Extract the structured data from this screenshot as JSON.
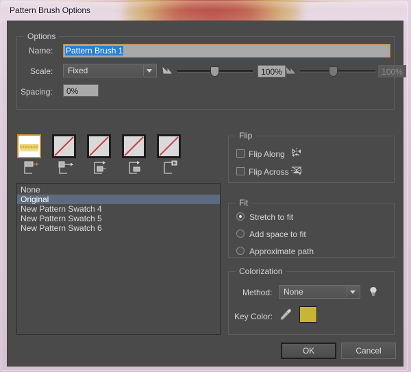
{
  "window": {
    "title": "Pattern Brush Options"
  },
  "options": {
    "group_label": "Options",
    "name_label": "Name:",
    "name_value": "Pattern Brush 1",
    "scale_label": "Scale:",
    "scale_value": "Fixed",
    "scale_slider_value": "100%",
    "scale_slider2_value": "100%",
    "spacing_label": "Spacing:",
    "spacing_value": "0%",
    "slider_icon_name": "scale-corner-icon"
  },
  "tiles": [
    {
      "name": "side-tile",
      "indicator": "side-tile-icon",
      "selected": true,
      "empty": false
    },
    {
      "name": "outer-corner-tile",
      "indicator": "outer-corner-tile-icon",
      "selected": false,
      "empty": true
    },
    {
      "name": "inner-corner-tile",
      "indicator": "inner-corner-tile-icon",
      "selected": false,
      "empty": true
    },
    {
      "name": "start-tile",
      "indicator": "start-tile-icon",
      "selected": false,
      "empty": true
    },
    {
      "name": "end-tile",
      "indicator": "end-tile-icon",
      "selected": false,
      "empty": true
    }
  ],
  "swatch_list": {
    "items": [
      {
        "label": "None",
        "selected": false
      },
      {
        "label": "Original",
        "selected": true
      },
      {
        "label": "New Pattern Swatch 4",
        "selected": false
      },
      {
        "label": "New Pattern Swatch 5",
        "selected": false
      },
      {
        "label": "New Pattern Swatch 6",
        "selected": false
      }
    ]
  },
  "flip": {
    "group_label": "Flip",
    "flip_along_label": "Flip Along",
    "flip_along_checked": false,
    "flip_along_icon": "flip-along-icon",
    "flip_across_label": "Flip Across",
    "flip_across_checked": false,
    "flip_across_icon": "flip-across-icon"
  },
  "fit": {
    "group_label": "Fit",
    "options": [
      {
        "label": "Stretch to fit",
        "selected": true
      },
      {
        "label": "Add space to fit",
        "selected": false
      },
      {
        "label": "Approximate path",
        "selected": false
      }
    ]
  },
  "colorization": {
    "group_label": "Colorization",
    "method_label": "Method:",
    "method_value": "None",
    "tip_icon": "lightbulb-icon",
    "key_color_label": "Key Color:",
    "eyedropper_icon": "eyedropper-icon",
    "key_color_hex": "#c9b535"
  },
  "footer": {
    "ok_label": "OK",
    "cancel_label": "Cancel"
  },
  "colors": {
    "dialog_bg": "#4a4a4a",
    "accent_focus": "#d08a2a",
    "selection_blue": "#2a7fd4",
    "list_selection": "#5d6b80",
    "key_color": "#c9b535"
  }
}
